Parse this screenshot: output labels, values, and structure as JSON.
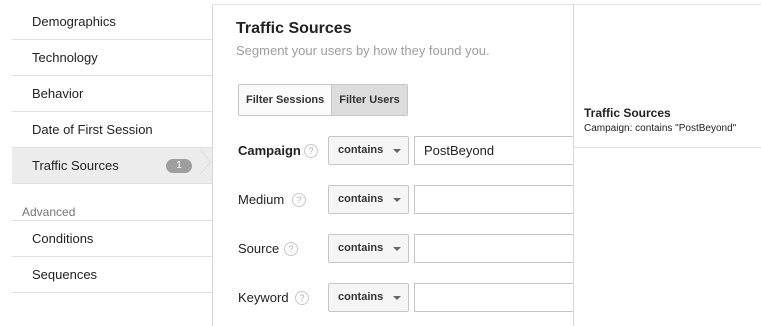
{
  "sidebar": {
    "items": [
      {
        "label": "Demographics"
      },
      {
        "label": "Technology"
      },
      {
        "label": "Behavior"
      },
      {
        "label": "Date of First Session"
      },
      {
        "label": "Traffic Sources",
        "badge": "1"
      }
    ],
    "advanced_label": "Advanced",
    "advanced_items": [
      {
        "label": "Conditions"
      },
      {
        "label": "Sequences"
      }
    ]
  },
  "main": {
    "title": "Traffic Sources",
    "subtitle": "Segment your users by how they found you.",
    "toggle": {
      "filter_sessions": "Filter Sessions",
      "filter_users": "Filter Users",
      "selected": "Filter Users"
    },
    "filters": [
      {
        "label": "Campaign",
        "operator": "contains",
        "value": "PostBeyond"
      },
      {
        "label": "Medium",
        "operator": "contains",
        "value": ""
      },
      {
        "label": "Source",
        "operator": "contains",
        "value": ""
      },
      {
        "label": "Keyword",
        "operator": "contains",
        "value": ""
      }
    ],
    "help_glyph": "?"
  },
  "summary": {
    "title": "Traffic Sources",
    "text": "Campaign: contains \"PostBeyond\""
  },
  "colors": {
    "active_bg": "#ececec",
    "badge_bg": "#9e9e9e",
    "border": "#c6c6c6"
  }
}
